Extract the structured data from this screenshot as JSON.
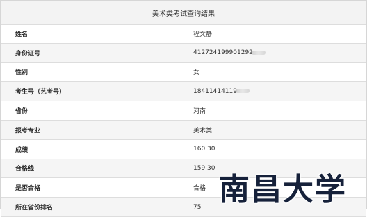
{
  "page": {
    "title": "美术类考试查询结果"
  },
  "rows": [
    {
      "label": "姓名",
      "value": "程文静"
    },
    {
      "label": "身份证号",
      "value": "412724199901292"
    },
    {
      "label": "性别",
      "value": "女"
    },
    {
      "label": "考生号（艺考号）",
      "value": "18411414119"
    },
    {
      "label": "省份",
      "value": "河南"
    },
    {
      "label": "报考专业",
      "value": "美术类"
    },
    {
      "label": "成绩",
      "value": "160.30"
    },
    {
      "label": "合格线",
      "value": "159.30"
    },
    {
      "label": "是否合格",
      "value": "合格"
    },
    {
      "label": "所在省份排名",
      "value": "75"
    }
  ],
  "watermark": {
    "text": "南昌大学"
  },
  "colors": {
    "header_bg": "#f3f3f3",
    "alt_row_bg": "#f5f5f5",
    "border": "#dddddd",
    "watermark": "#16213a"
  }
}
